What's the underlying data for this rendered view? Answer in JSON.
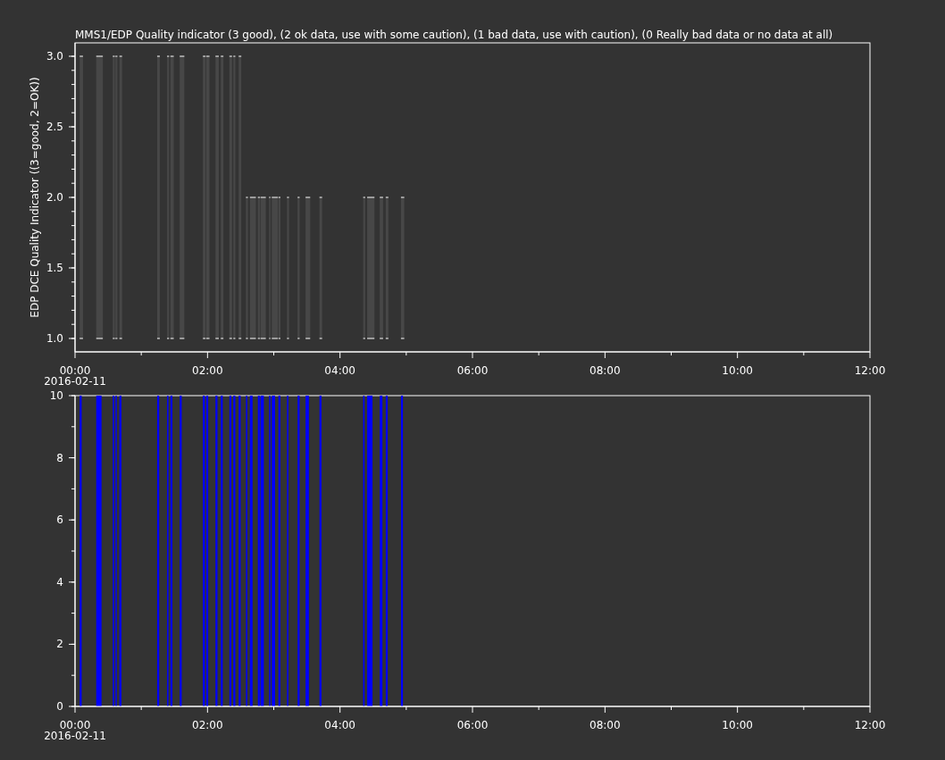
{
  "title": "MMS1/EDP  Quality indicator (3 good), (2 ok data, use with some caution), (1 bad data, use with caution), (0 Really bad data or no data at all)",
  "charts": [
    {
      "kind": "quality",
      "ylabel": "EDP DCE Quality Indicator ((3=good, 2=OK))",
      "y_tick_labels": [
        "3.0",
        "2.5",
        "2.0",
        "1.5",
        "1.0"
      ],
      "x_tick_labels": [
        "00:00",
        "02:00",
        "04:00",
        "06:00",
        "08:00",
        "10:00",
        "12:00"
      ],
      "date_label": "2016-02-11"
    },
    {
      "kind": "flags",
      "y_tick_labels": [
        "10",
        "8",
        "6",
        "4",
        "2",
        "0"
      ],
      "x_tick_labels": [
        "00:00",
        "02:00",
        "04:00",
        "06:00",
        "08:00",
        "10:00",
        "12:00"
      ],
      "date_label": "2016-02-11"
    }
  ]
}
